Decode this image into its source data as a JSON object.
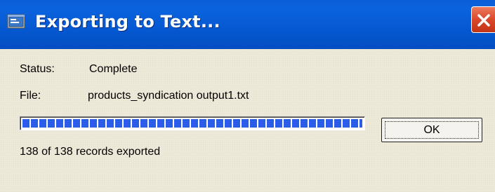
{
  "window": {
    "title": "Exporting to Text...",
    "icon": "export-window-icon",
    "close_icon": "close-icon",
    "accent_color": "#0558d1",
    "close_color": "#d9482a"
  },
  "status": {
    "label": "Status:",
    "value": "Complete"
  },
  "file": {
    "label": "File:",
    "value": "products_syndication output1.txt"
  },
  "progress": {
    "fraction": 1.0,
    "color": "#2a5ee8"
  },
  "records_text": "138 of 138 records exported",
  "buttons": {
    "ok_label": "OK"
  }
}
